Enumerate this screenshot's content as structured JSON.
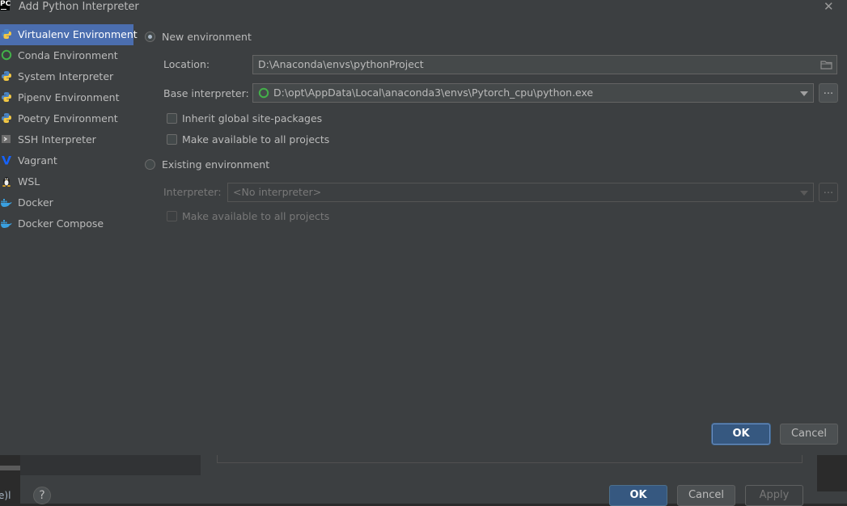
{
  "background": {
    "ok_label": "OK",
    "cancel_label": "Cancel",
    "apply_label": "Apply",
    "help_label": "?",
    "left_text": "e)l"
  },
  "dialog": {
    "title": "Add Python Interpreter",
    "app_logo": "PC",
    "close_label": "✕",
    "ok_label": "OK",
    "cancel_label": "Cancel"
  },
  "sidebar": {
    "items": [
      {
        "label": "Virtualenv Environment",
        "icon": "python-icon",
        "selected": true
      },
      {
        "label": "Conda Environment",
        "icon": "conda-icon"
      },
      {
        "label": "System Interpreter",
        "icon": "python-icon"
      },
      {
        "label": "Pipenv Environment",
        "icon": "pipenv-icon"
      },
      {
        "label": "Poetry Environment",
        "icon": "poetry-icon"
      },
      {
        "label": "SSH Interpreter",
        "icon": "ssh-icon"
      },
      {
        "label": "Vagrant",
        "icon": "vagrant-icon"
      },
      {
        "label": "WSL",
        "icon": "linux-icon"
      },
      {
        "label": "Docker",
        "icon": "docker-icon"
      },
      {
        "label": "Docker Compose",
        "icon": "docker-icon"
      }
    ]
  },
  "new_env": {
    "radio_label": "New environment",
    "location_label": "Location:",
    "location_value": "D:\\Anaconda\\envs\\pythonProject",
    "base_label": "Base interpreter:",
    "base_value": "D:\\opt\\AppData\\Local\\anaconda3\\envs\\Pytorch_cpu\\python.exe",
    "browse_label": "...",
    "inherit_label": "Inherit global site-packages",
    "make_available_label": "Make available to all projects"
  },
  "existing_env": {
    "radio_label": "Existing environment",
    "interpreter_label": "Interpreter:",
    "interpreter_value": "<No interpreter>",
    "browse_label": "...",
    "make_available_label": "Make available to all projects"
  },
  "colors": {
    "selection": "#4b6eaf",
    "dialog_bg": "#3c3f41",
    "primary_button": "#365880"
  }
}
